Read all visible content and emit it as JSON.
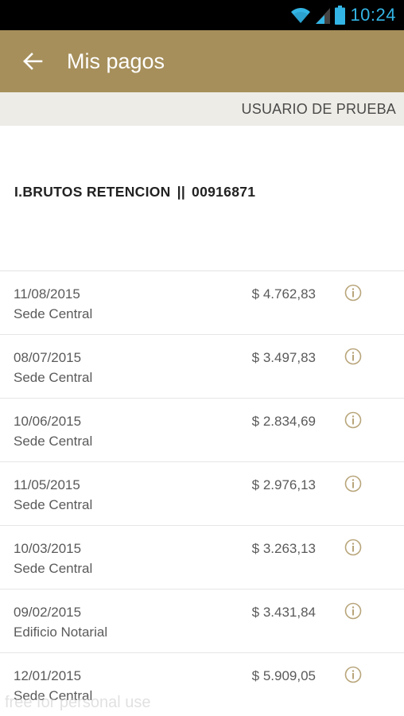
{
  "status_bar": {
    "time": "10:24",
    "icons": [
      "wifi-icon",
      "signal-icon",
      "battery-icon"
    ]
  },
  "app_bar": {
    "title": "Mis pagos",
    "back_icon": "arrow-back-icon"
  },
  "user": {
    "name": "USUARIO DE PRUEBA"
  },
  "account": {
    "name": "I.BRUTOS RETENCION",
    "separator": "||",
    "number": "00916871"
  },
  "payments": [
    {
      "date": "11/08/2015",
      "place": "Sede Central",
      "amount": "$ 4.762,83"
    },
    {
      "date": "08/07/2015",
      "place": "Sede Central",
      "amount": "$ 3.497,83"
    },
    {
      "date": "10/06/2015",
      "place": "Sede Central",
      "amount": "$ 2.834,69"
    },
    {
      "date": "11/05/2015",
      "place": "Sede Central",
      "amount": "$ 2.976,13"
    },
    {
      "date": "10/03/2015",
      "place": "Sede Central",
      "amount": "$ 3.263,13"
    },
    {
      "date": "09/02/2015",
      "place": "Edificio Notarial",
      "amount": "$ 3.431,84"
    },
    {
      "date": "12/01/2015",
      "place": "Sede Central",
      "amount": "$ 5.909,05"
    }
  ],
  "watermark": "free for personal use",
  "colors": {
    "app_bar": "#a68f5b",
    "user_bar": "#eeece6",
    "status_accent": "#33b5e5",
    "info_icon": "#b8a57a"
  }
}
